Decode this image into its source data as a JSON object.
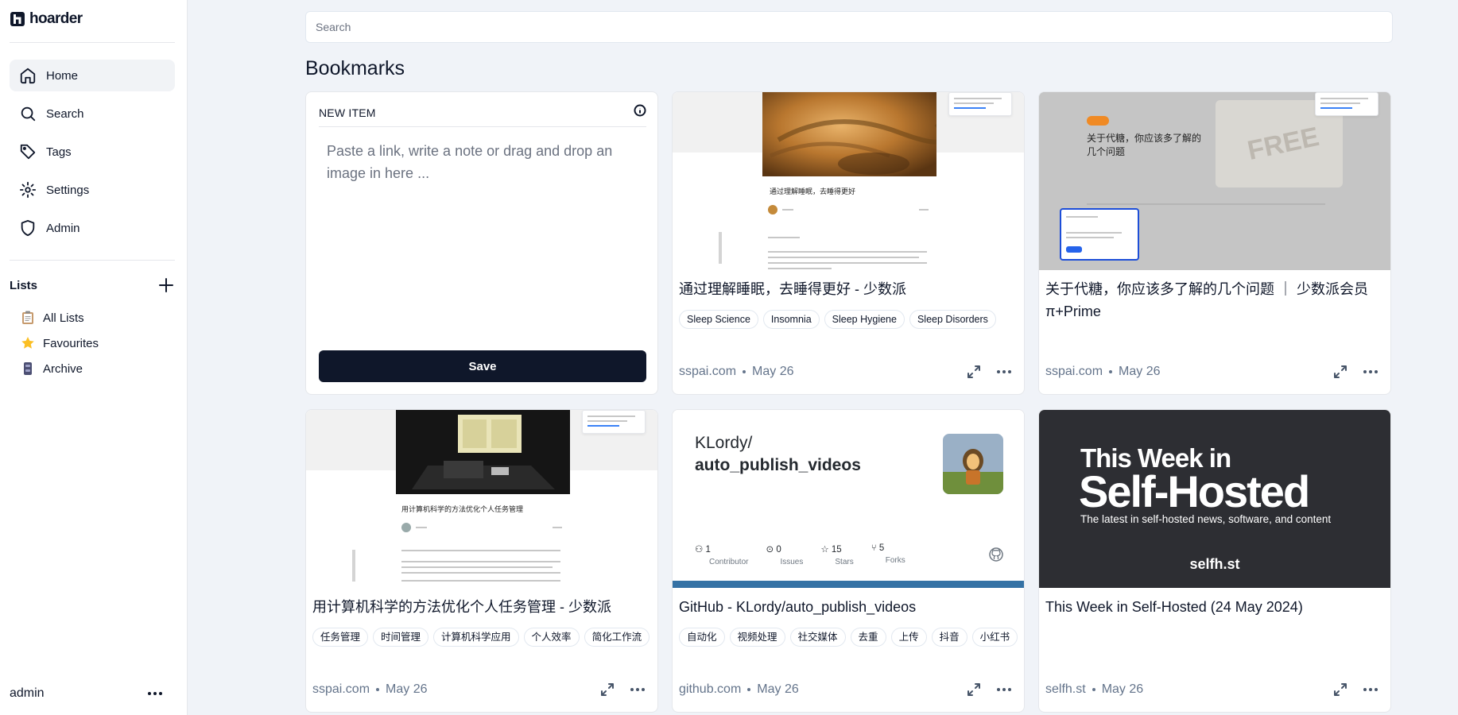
{
  "app": {
    "name": "hoarder"
  },
  "sidebar": {
    "nav": [
      {
        "label": "Home",
        "icon": "home-icon",
        "active": true
      },
      {
        "label": "Search",
        "icon": "search-icon"
      },
      {
        "label": "Tags",
        "icon": "tag-icon"
      },
      {
        "label": "Settings",
        "icon": "gear-icon"
      },
      {
        "label": "Admin",
        "icon": "shield-icon"
      }
    ],
    "lists_title": "Lists",
    "lists": [
      {
        "label": "All Lists",
        "icon": "clipboard-emoji-icon"
      },
      {
        "label": "Favourites",
        "icon": "star-emoji-icon"
      },
      {
        "label": "Archive",
        "icon": "archive-emoji-icon"
      }
    ],
    "user": "admin"
  },
  "search": {
    "placeholder": "Search"
  },
  "page_title": "Bookmarks",
  "new_item": {
    "label": "NEW ITEM",
    "placeholder": "Paste a link, write a note or drag and drop an image in here ...",
    "save_label": "Save"
  },
  "bookmarks": [
    {
      "title": "通过理解睡眠，去睡得更好 - 少数派",
      "tags": [
        "Sleep Science",
        "Insomnia",
        "Sleep Hygiene",
        "Sleep Disorders"
      ],
      "domain": "sspai.com",
      "date": "May 26",
      "thumb_heading": "通过理解睡眠，去睡得更好"
    },
    {
      "title": "关于代糖，你应该多了解的几个问题 ｜ 少数派会员 π+Prime",
      "tags": [],
      "domain": "sspai.com",
      "date": "May 26",
      "thumb_heading": "关于代糖，你应该多了解的几个问题"
    },
    {
      "title": "用计算机科学的方法优化个人任务管理 - 少数派",
      "tags": [
        "任务管理",
        "时间管理",
        "计算机科学应用",
        "个人效率",
        "简化工作流"
      ],
      "domain": "sspai.com",
      "date": "May 26",
      "thumb_heading": "用计算机科学的方法优化个人任务管理"
    },
    {
      "title": "GitHub - KLordy/auto_publish_videos",
      "tags": [
        "自动化",
        "视频处理",
        "社交媒体",
        "去重",
        "上传",
        "抖音",
        "小红书"
      ],
      "domain": "github.com",
      "date": "May 26",
      "preview": {
        "owner": "KLordy/",
        "repo": "auto_publish_videos",
        "stats": [
          {
            "value": "1",
            "label": "Contributor",
            "icon": "people-icon"
          },
          {
            "value": "0",
            "label": "Issues",
            "icon": "issue-icon"
          },
          {
            "value": "15",
            "label": "Stars",
            "icon": "star-icon"
          },
          {
            "value": "5",
            "label": "Forks",
            "icon": "fork-icon"
          }
        ],
        "language_color": "#3572a5"
      }
    },
    {
      "title": "This Week in Self-Hosted (24 May 2024)",
      "tags": [],
      "domain": "selfh.st",
      "date": "May 26",
      "preview": {
        "line1": "This Week in",
        "line2": "Self-Hosted",
        "line3": "The latest in self-hosted news, software, and content",
        "brand": "selfh.st"
      }
    }
  ],
  "colors": {
    "accent": "#0f172a",
    "background": "#f0f3f8",
    "muted": "#64748b"
  }
}
